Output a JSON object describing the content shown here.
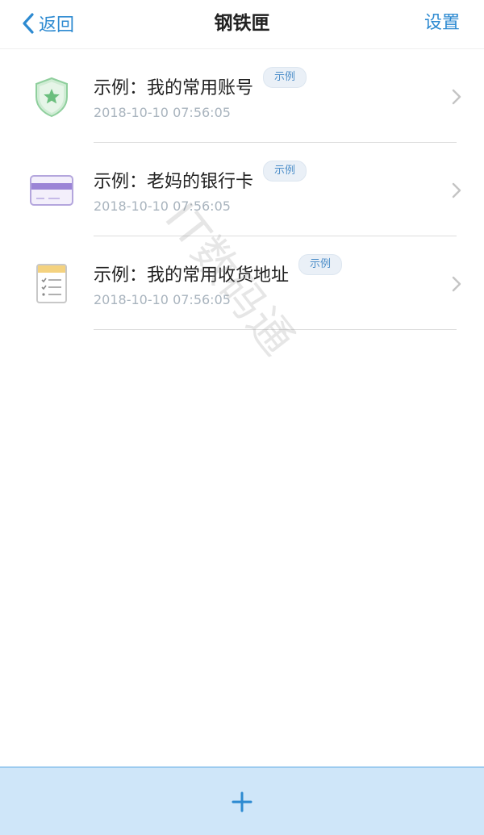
{
  "navbar": {
    "back_label": "返回",
    "title": "钢铁匣",
    "settings_label": "设置"
  },
  "items": [
    {
      "icon": "shield-star-icon",
      "title": "示例：我的常用账号",
      "badge": "示例",
      "time": "2018-10-10 07:56:05"
    },
    {
      "icon": "bank-card-icon",
      "title": "示例：老妈的银行卡",
      "badge": "示例",
      "time": "2018-10-10 07:56:05"
    },
    {
      "icon": "notepad-icon",
      "title": "示例：我的常用收货地址",
      "badge": "示例",
      "time": "2018-10-10 07:56:05"
    }
  ],
  "watermark": "IT数码通",
  "colors": {
    "accent": "#2d8ad1",
    "bottom_bar": "#cfe6f9",
    "badge_bg": "#eaf0f7",
    "badge_text": "#4d8ec9",
    "time_text": "#a9b4be"
  }
}
